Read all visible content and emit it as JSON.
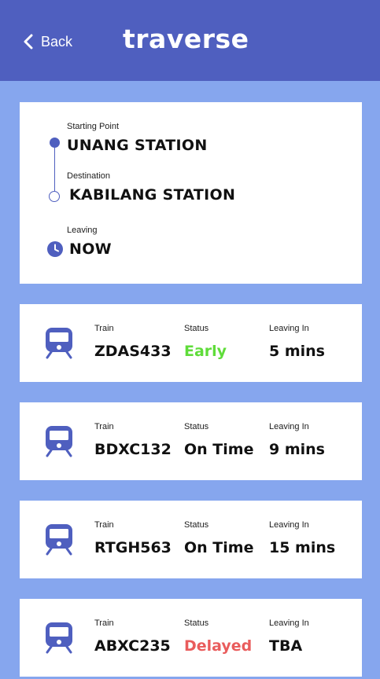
{
  "header": {
    "back_label": "Back",
    "logo_text": "traverse"
  },
  "route": {
    "start_label": "Starting Point",
    "start_value": "UNANG STATION",
    "destination_label": "Destination",
    "destination_value": "KABILANG STATION",
    "leaving_label": "Leaving",
    "leaving_value": "NOW"
  },
  "columns": {
    "train": "Train",
    "status": "Status",
    "leaving_in": "Leaving In"
  },
  "trains": [
    {
      "id": "ZDAS433",
      "status": "Early",
      "status_color": "#5fdc3a",
      "leaving_in": "5 mins"
    },
    {
      "id": "BDXC132",
      "status": "On Time",
      "status_color": "#111111",
      "leaving_in": "9 mins"
    },
    {
      "id": "RTGH563",
      "status": "On Time",
      "status_color": "#111111",
      "leaving_in": "15 mins"
    },
    {
      "id": "ABXC235",
      "status": "Delayed",
      "status_color": "#e95c5c",
      "leaving_in": "TBA"
    }
  ],
  "colors": {
    "header_bg": "#4f5fbf",
    "page_bg": "#86a6ee",
    "accent": "#4f5fbf"
  },
  "icons": {
    "back": "chevron-left-icon",
    "leaving": "clock-icon",
    "train": "train-icon"
  }
}
